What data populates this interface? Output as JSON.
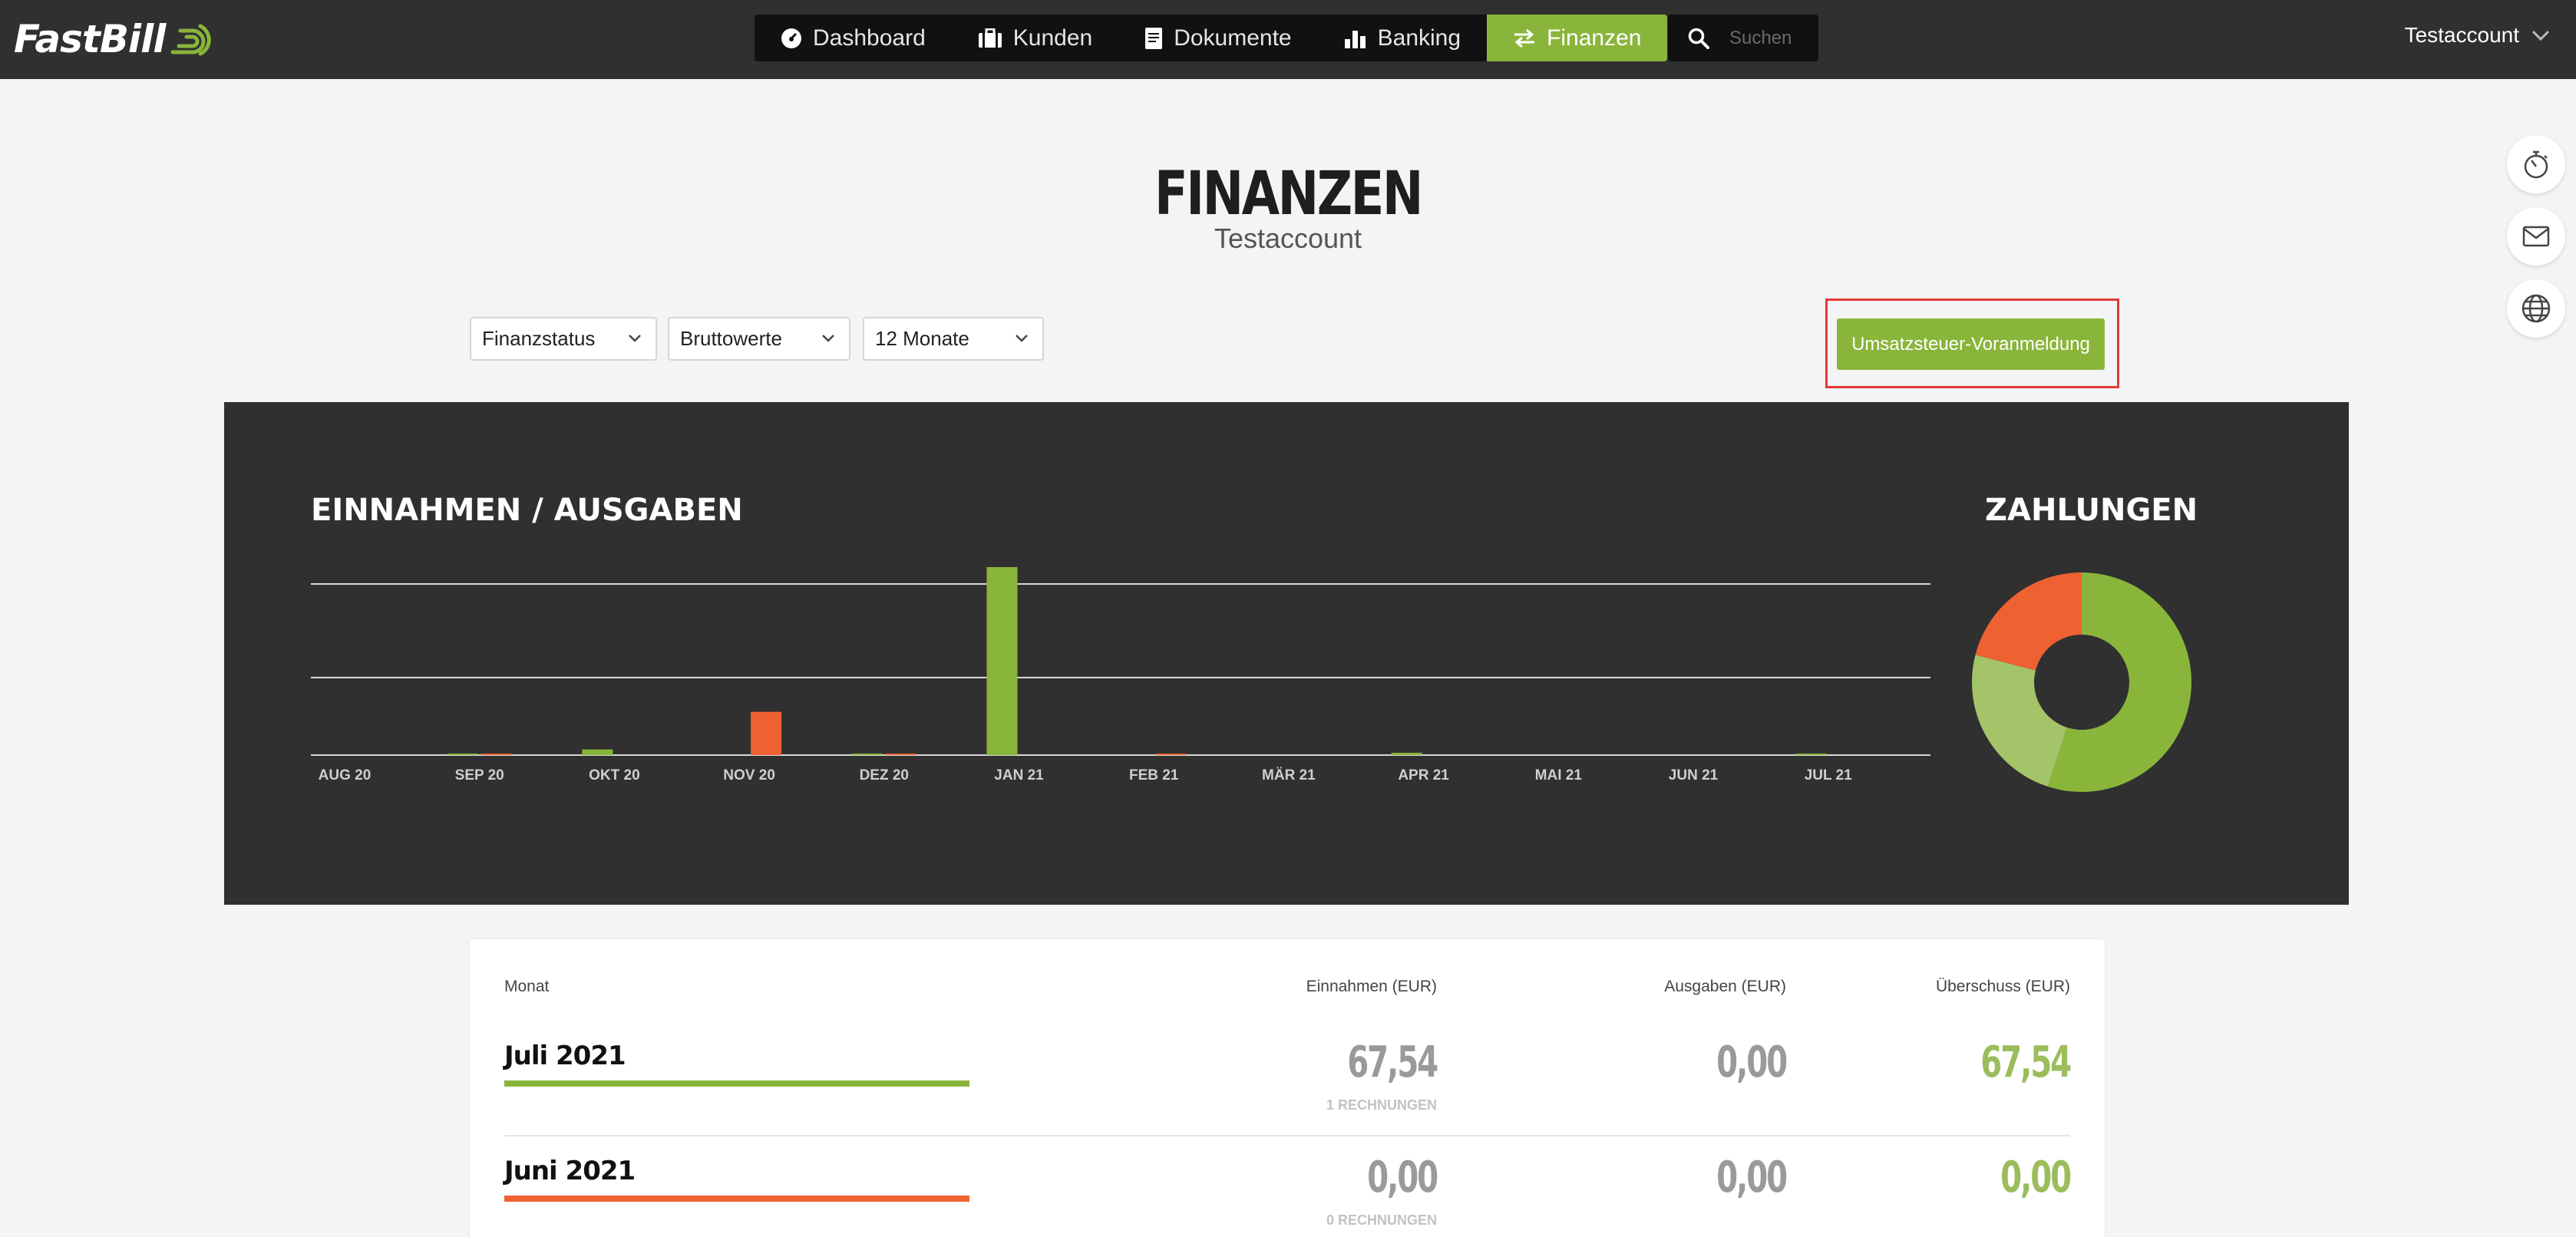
{
  "app": {
    "logo": "FastBill"
  },
  "nav": {
    "items": [
      {
        "label": "Dashboard",
        "icon": "dashboard-icon"
      },
      {
        "label": "Kunden",
        "icon": "briefcase-icon"
      },
      {
        "label": "Dokumente",
        "icon": "document-icon"
      },
      {
        "label": "Banking",
        "icon": "bar-chart-icon"
      },
      {
        "label": "Finanzen",
        "icon": "transfer-arrows-icon",
        "active": true
      }
    ]
  },
  "search": {
    "placeholder": "Suchen"
  },
  "account": {
    "name": "Testaccount"
  },
  "page": {
    "title": "FINANZEN",
    "subtitle": "Testaccount"
  },
  "filters": {
    "view": "Finanzstatus",
    "values": "Bruttowerte",
    "period": "12 Monate"
  },
  "actions": {
    "vat_button": "Umsatzsteuer-Voranmeldung"
  },
  "side_tools": [
    "stopwatch-icon",
    "mail-icon",
    "globe-icon"
  ],
  "colors": {
    "income": "#8ab53b",
    "expense": "#ee6130",
    "income_light": "#a3c468",
    "panel": "#303030",
    "active_nav": "#8ab53b"
  },
  "chart_panel": {
    "bars_title": "EINNAHMEN / AUSGABEN",
    "pie_title": "ZAHLUNGEN"
  },
  "chart_data": [
    {
      "type": "bar",
      "title": "EINNAHMEN / AUSGABEN",
      "categories": [
        "AUG 20",
        "SEP 20",
        "OKT 20",
        "NOV 20",
        "DEZ 20",
        "JAN 21",
        "FEB 21",
        "MÄR 21",
        "APR 21",
        "MAI 21",
        "JUN 21",
        "JUL 21"
      ],
      "series": [
        {
          "color": "#8ab53b",
          "values": [
            0,
            3,
            12,
            0,
            3,
            400,
            0,
            0,
            5,
            0,
            0,
            2
          ]
        },
        {
          "color": "#ee6130",
          "values": [
            0,
            3,
            0,
            92,
            3,
            0,
            3,
            0,
            0,
            0,
            0,
            0
          ]
        }
      ],
      "ylim": [
        0,
        400
      ],
      "grid": true
    },
    {
      "type": "pie",
      "title": "ZAHLUNGEN",
      "donut": true,
      "slices": [
        {
          "value": 55,
          "color": "#8ab53b"
        },
        {
          "value": 24,
          "color": "#a3c468"
        },
        {
          "value": 21,
          "color": "#ee6130"
        }
      ]
    }
  ],
  "table": {
    "headers": {
      "month": "Monat",
      "income": "Einnahmen (EUR)",
      "expenses": "Ausgaben (EUR)",
      "surplus": "Überschuss (EUR)"
    },
    "rows": [
      {
        "month": "Juli 2021",
        "income": "67,54",
        "invoices": "1 RECHNUNGEN",
        "expenses": "0,00",
        "surplus": "67,54",
        "bar_color": "#8ab53b",
        "surplus_color": "#9bbd5c"
      },
      {
        "month": "Juni 2021",
        "income": "0,00",
        "invoices": "0 RECHNUNGEN",
        "expenses": "0,00",
        "surplus": "0,00",
        "bar_color": "#ee6130",
        "surplus_color": "#9bbd5c"
      }
    ]
  }
}
